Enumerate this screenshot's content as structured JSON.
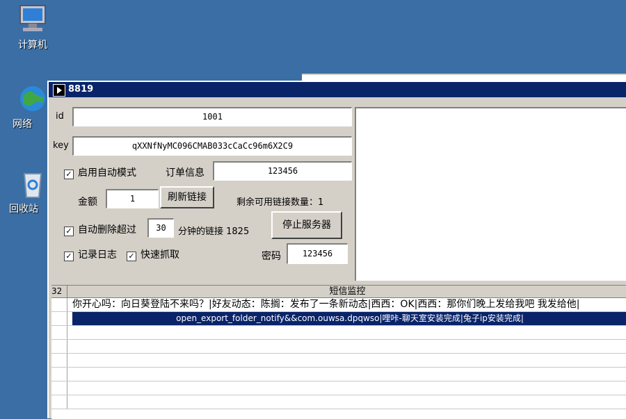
{
  "desktop": {
    "icons": [
      {
        "label": "计算机",
        "icon": "computer-icon"
      },
      {
        "label": "网络",
        "icon": "network-icon"
      },
      {
        "label": "回收站",
        "icon": "recycle-bin-icon"
      }
    ]
  },
  "window": {
    "title": "8819",
    "id_label": "id",
    "id_value": "1001",
    "key_label": "key",
    "key_value": "qXXNfNyMC096CMAB033cCaCc96m6X2C9",
    "auto_mode_label": "启用自动模式",
    "auto_mode_checked": true,
    "order_info_label": "订单信息",
    "order_info_value": "123456",
    "amount_label": "金额",
    "amount_value": "1",
    "refresh_button": "刷新链接",
    "remaining_links": "剩余可用链接数量：1",
    "auto_delete_label": "自动删除超过",
    "auto_delete_checked": true,
    "auto_delete_minutes": "30",
    "auto_delete_suffix": "分钟的链接 1825",
    "stop_server_button": "停止服务器",
    "log_label": "记录日志",
    "log_checked": true,
    "fast_fetch_label": "快速抓取",
    "fast_fetch_checked": true,
    "password_label": "密码",
    "password_value": "123456"
  },
  "grid": {
    "rownum_header": "32",
    "column_title": "短信监控",
    "rows": [
      "你开心吗：向日葵登陆不来吗？|好友动态：陈搁：发布了一条新动态|西西：OK|西西：那你们晚上发给我吧 我发给他|",
      "open_export_folder_notify&&com.ouwsa.dpqwso|哩咔-聊天室安装完成|兔子ip安装完成|"
    ]
  }
}
